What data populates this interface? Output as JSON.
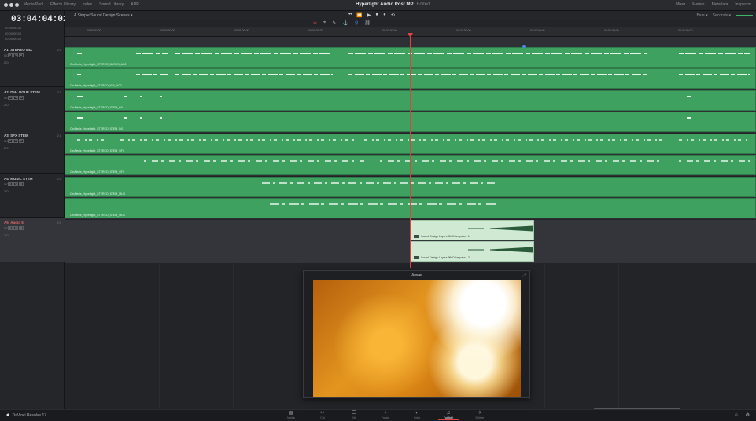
{
  "window": {
    "title": "Hyperlight Audio Post MP",
    "subtitle": "Edited",
    "left_menu": [
      "Media Pool",
      "Effects Library",
      "Index",
      "Sound Library",
      "ADR"
    ],
    "right_menu": [
      "Mixer",
      "Meters",
      "Metadata",
      "Inspector"
    ]
  },
  "header": {
    "timecode": "03:04:04:02",
    "tc_rows": [
      "00:00:00:00",
      "00:00:00:00",
      "00:00:00:00"
    ],
    "timeline_name": "A Simple Sound Design Scenes ▾"
  },
  "transport": {
    "buttons": [
      "⏮",
      "⏪",
      "▶",
      "■",
      "●",
      "⟲"
    ],
    "right": [
      "Bars ▾",
      "Seconds ▾"
    ]
  },
  "toolbar": {
    "icons": [
      "✂",
      "⌖",
      "✎",
      "⚓",
      "⚲",
      "⛓"
    ]
  },
  "ruler": {
    "ticks": [
      "00:00:00:00",
      "00:00:30:00",
      "00:01:00:00",
      "00:01:30:00",
      "00:02:00:00",
      "00:02:30:00",
      "00:03:00:00",
      "00:03:30:00",
      "00:04:00:00"
    ]
  },
  "tracks": [
    {
      "id": "A1",
      "name": "STEREO MIX",
      "type": "2.0",
      "vol": "0.0",
      "clips_label": "2.0",
      "clips": [
        "CinAlexis_Hyperlight_STEREO_BUSHS_AC2",
        "CinAlexis_Hyperlight_STEREO_MIX_AC2"
      ]
    },
    {
      "id": "A2",
      "name": "DIALOGUE STEM",
      "type": "2.0",
      "vol": "0.0",
      "clips_label": "2.0",
      "clips": [
        "CinAlexis_Hyperlight_STEREO_STEM_DX",
        "CinAlexis_Hyperlight_STEREO_STEM_DX"
      ]
    },
    {
      "id": "A3",
      "name": "SFX STEM",
      "type": "2.0",
      "vol": "0.0",
      "clips_label": "2.0",
      "clips": [
        "CinAlexis_Hyperlight_STEREO_STEM_SFX",
        "CinAlexis_Hyperlight_STEREO_STEM_SFX"
      ]
    },
    {
      "id": "A4",
      "name": "MUSIC STEM",
      "type": "2.0",
      "vol": "0.0",
      "clips_label": "2.0",
      "clips": [
        "CinAlexis_Hyperlight_STEREO_STEM_MUS",
        "CinAlexis_Hyperlight_STEREO_STEM_MUS"
      ]
    },
    {
      "id": "A5",
      "name": "Audio 5",
      "type": "2.0",
      "vol": "0.0",
      "clips_label": "1.0",
      "clips": [
        "Sound Design Layers 9fb Drive pass - 1",
        "Sound Design Layers 9fb Drive pass - 2"
      ]
    }
  ],
  "viewer": {
    "title": "Viewer"
  },
  "pagebar": {
    "brand": "DaVinci Resolve 17",
    "pages": [
      {
        "label": "Media",
        "icon": "▦"
      },
      {
        "label": "Cut",
        "icon": "✂"
      },
      {
        "label": "Edit",
        "icon": "☰"
      },
      {
        "label": "Fusion",
        "icon": "✧"
      },
      {
        "label": "Color",
        "icon": "◐"
      },
      {
        "label": "Fairlight",
        "icon": "♫"
      },
      {
        "label": "Deliver",
        "icon": "✈"
      }
    ],
    "active": "Fairlight"
  },
  "colors": {
    "clip_green": "#3fa160",
    "playhead": "#e14141",
    "sound_design_clip": "#cfe9d3"
  }
}
